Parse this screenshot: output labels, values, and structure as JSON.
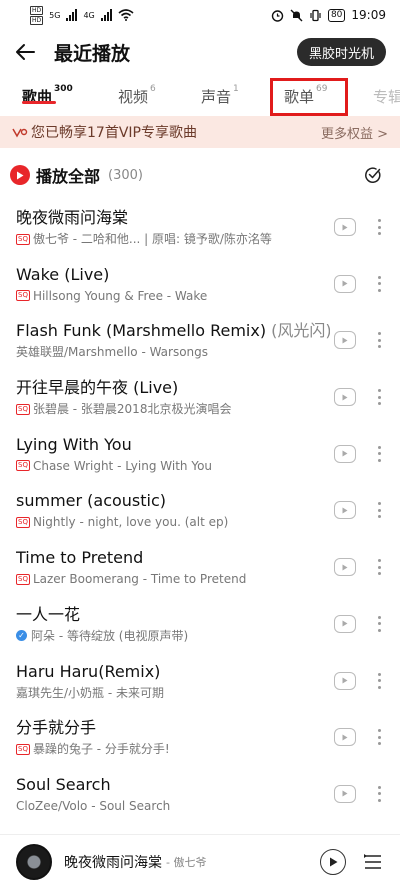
{
  "status_bar": {
    "sim1": "HD",
    "sim2": "HD",
    "signal_label": "5G",
    "signal2_label": "4G",
    "time": "19:09",
    "battery": "80"
  },
  "header": {
    "title": "最近播放",
    "vinyl_button": "黑胶时光机"
  },
  "tabs": [
    {
      "label": "歌曲",
      "count": "300",
      "active": true
    },
    {
      "label": "视频",
      "count": "6"
    },
    {
      "label": "声音",
      "count": "1"
    },
    {
      "label": "歌单",
      "count": "69"
    },
    {
      "label": "专辑",
      "count": ""
    }
  ],
  "vip_banner": {
    "text": "您已畅享17首VIP专享歌曲",
    "more": "更多权益 >"
  },
  "play_all": {
    "label": "播放全部",
    "count": "(300)"
  },
  "songs": [
    {
      "title": "晚夜微雨问海棠",
      "alias": "",
      "subtitle": "傲七爷 - 二哈和他... | 原唱: 镜予歌/陈亦洺等",
      "badge": "SQ"
    },
    {
      "title": "Wake (Live)",
      "alias": "",
      "subtitle": "Hillsong Young & Free - Wake",
      "badge": "SQ"
    },
    {
      "title": "Flash Funk (Marshmello Remix)",
      "alias": "(风光闪)",
      "subtitle": "英雄联盟/Marshmello - Warsongs",
      "badge": ""
    },
    {
      "title": "开往早晨的午夜 (Live)",
      "alias": "",
      "subtitle": "张碧晨 - 张碧晨2018北京极光演唱会",
      "badge": "SQ"
    },
    {
      "title": "Lying With You",
      "alias": "",
      "subtitle": "Chase Wright - Lying With You",
      "badge": "SQ"
    },
    {
      "title": "summer (acoustic)",
      "alias": "",
      "subtitle": "Nightly - night, love you. (alt ep)",
      "badge": "SQ"
    },
    {
      "title": "Time to Pretend",
      "alias": "",
      "subtitle": "Lazer Boomerang - Time to Pretend",
      "badge": "SQ"
    },
    {
      "title": "一人一花",
      "alias": "",
      "subtitle": "阿朵 - 等待绽放 (电视原声带)",
      "badge": "V"
    },
    {
      "title": "Haru Haru(Remix)",
      "alias": "",
      "subtitle": "嘉琪先生/小奶瓶 - 未来可期",
      "badge": ""
    },
    {
      "title": "分手就分手",
      "alias": "",
      "subtitle": "暴躁的兔子 - 分手就分手!",
      "badge": "SQ"
    },
    {
      "title": "Soul Search",
      "alias": "",
      "subtitle": "CloZee/Volo - Soul Search",
      "badge": ""
    }
  ],
  "mini_player": {
    "title": "晚夜微雨问海棠",
    "artist": "- 傲七爷"
  },
  "colors": {
    "accent": "#e8262a",
    "highlight_box": "#e11b1b",
    "vip_banner_bg": "#fbe8e2"
  }
}
